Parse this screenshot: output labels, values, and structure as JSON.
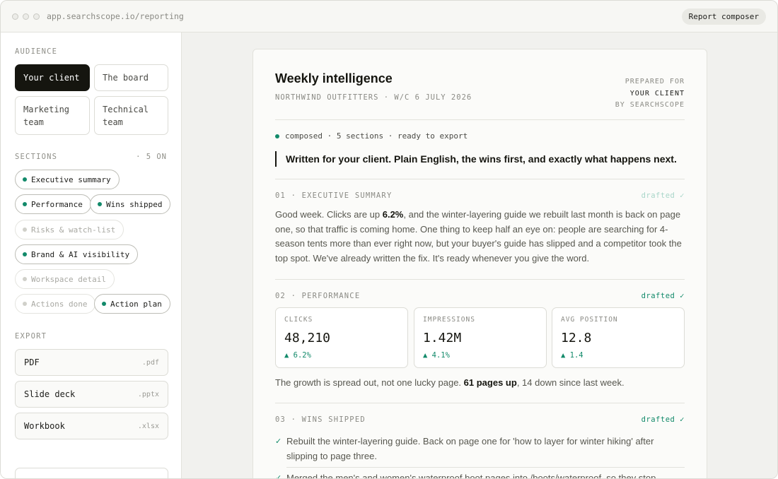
{
  "window": {
    "url": "app.searchscope.io/reporting",
    "composer_label": "Report composer"
  },
  "sidebar": {
    "audience_label": "AUDIENCE",
    "audience": [
      {
        "label": "Your client",
        "active": true
      },
      {
        "label": "The board",
        "active": false
      },
      {
        "label": "Marketing team",
        "active": false
      },
      {
        "label": "Technical team",
        "active": false
      }
    ],
    "sections_label": "SECTIONS",
    "sections_count": "· 5 ON",
    "sections": [
      {
        "label": "Executive summary",
        "on": true
      },
      {
        "label": "Performance",
        "on": true
      },
      {
        "label": "Wins shipped",
        "on": true
      },
      {
        "label": "Risks & watch-list",
        "on": false
      },
      {
        "label": "Brand & AI visibility",
        "on": true
      },
      {
        "label": "Workspace detail",
        "on": false
      },
      {
        "label": "Actions done",
        "on": false
      },
      {
        "label": "Action plan",
        "on": true
      }
    ],
    "export_label": "EXPORT",
    "exports": [
      {
        "name": "PDF",
        "ext": ".pdf"
      },
      {
        "name": "Slide deck",
        "ext": ".pptx"
      },
      {
        "name": "Workbook",
        "ext": ".xlsx"
      }
    ]
  },
  "report": {
    "title": "Weekly intelligence",
    "subtitle": "NORTHWIND OUTFITTERS · W/C 6 JULY 2026",
    "prepared_for": "PREPARED FOR",
    "prepared_client": "YOUR CLIENT",
    "prepared_by": "BY SEARCHSCOPE",
    "status": "composed · 5 sections · ready to export",
    "lede": "Written for your client. Plain English, the wins first, and exactly what happens next.",
    "sections": {
      "exec": {
        "heading": "01 · EXECUTIVE SUMMARY",
        "state": "drafted ✓",
        "p1": "Good week. Clicks are up ",
        "b1": "6.2%",
        "p2": ", and the winter-layering guide we rebuilt last month is back on page one, so that traffic is coming home. One thing to keep half an eye on: people are searching for 4-season tents more than ever right now, but your buyer's guide has slipped and a competitor took the top spot. We've already written the fix. It's ready whenever you give the word."
      },
      "perf": {
        "heading": "02 · PERFORMANCE",
        "state": "drafted ✓",
        "stats": [
          {
            "label": "CLICKS",
            "value": "48,210",
            "delta": "▲ 6.2%"
          },
          {
            "label": "IMPRESSIONS",
            "value": "1.42M",
            "delta": "▲ 4.1%"
          },
          {
            "label": "AVG POSITION",
            "value": "12.8",
            "delta": "▲ 1.4"
          }
        ],
        "p1": "The growth is spread out, not one lucky page. ",
        "b1": "61 pages up",
        "p2": ", 14 down since last week."
      },
      "wins": {
        "heading": "03 · WINS SHIPPED",
        "state": "drafted ✓",
        "items": [
          "Rebuilt the winter-layering guide. Back on page one for 'how to layer for winter hiking' after slipping to page three.",
          "Merged the men's and women's waterproof boot pages into /boots/waterproof, so they stop splitting"
        ]
      }
    }
  }
}
